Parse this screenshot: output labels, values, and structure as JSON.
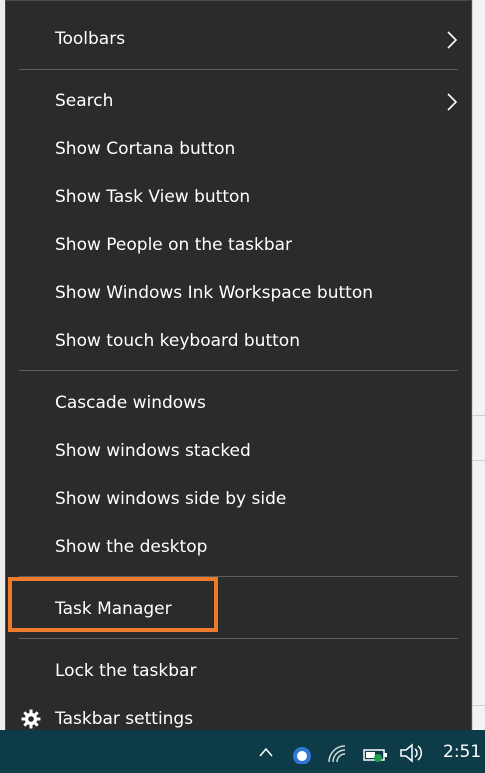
{
  "menu": {
    "items": [
      {
        "label": "Toolbars",
        "has_submenu": true
      },
      {
        "label": "Search",
        "has_submenu": true
      },
      {
        "label": "Show Cortana button"
      },
      {
        "label": "Show Task View button"
      },
      {
        "label": "Show People on the taskbar"
      },
      {
        "label": "Show Windows Ink Workspace button"
      },
      {
        "label": "Show touch keyboard button"
      },
      {
        "label": "Cascade windows"
      },
      {
        "label": "Show windows stacked"
      },
      {
        "label": "Show windows side by side"
      },
      {
        "label": "Show the desktop"
      },
      {
        "label": "Task Manager",
        "highlighted": true
      },
      {
        "label": "Lock the taskbar"
      },
      {
        "label": "Taskbar settings",
        "icon": "gear-icon"
      }
    ]
  },
  "taskbar": {
    "clock": "2:51",
    "tray_icons": [
      "chevron-up-icon",
      "onedrive-icon",
      "wifi-icon",
      "battery-icon",
      "volume-icon"
    ]
  },
  "colors": {
    "menu_background": "#2b2b2b",
    "menu_text": "#ffffff",
    "highlight_border": "#ec7b2b",
    "taskbar_background": "#0d3b47"
  }
}
